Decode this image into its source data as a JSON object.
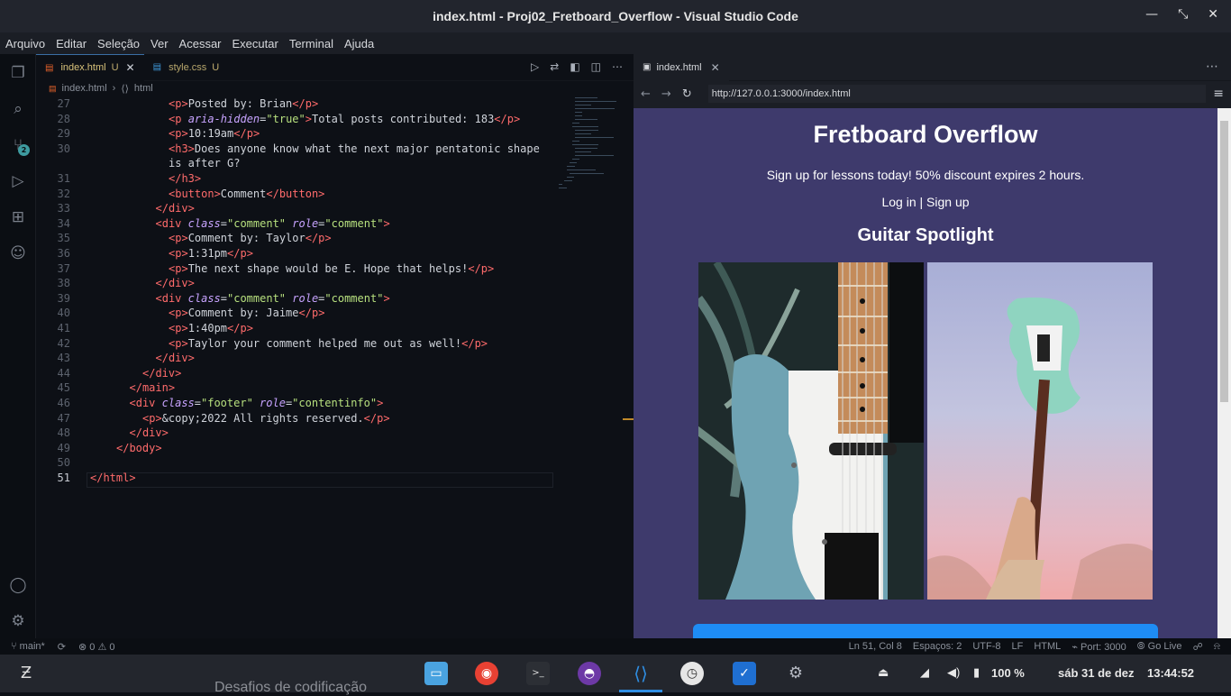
{
  "window": {
    "title": "index.html - Proj02_Fretboard_Overflow - Visual Studio Code"
  },
  "menu": [
    "Arquivo",
    "Editar",
    "Seleção",
    "Ver",
    "Acessar",
    "Executar",
    "Terminal",
    "Ajuda"
  ],
  "tabs": [
    {
      "label": "index.html",
      "status": "U",
      "active": true
    },
    {
      "label": "style.css",
      "status": "U",
      "active": false
    }
  ],
  "breadcrumb": {
    "file": "index.html",
    "node": "html"
  },
  "source_control_badge": "2",
  "code_lines": [
    {
      "n": "27",
      "indent": 6,
      "html": "<span class=\"tg\">&lt;p&gt;</span>Posted by: Brian<span class=\"tg\">&lt;/p&gt;</span>"
    },
    {
      "n": "28",
      "indent": 6,
      "html": "<span class=\"tg\">&lt;p</span> <span class=\"at\">aria-hidden</span>=<span class=\"st\">\"true\"</span><span class=\"tg\">&gt;</span>Total posts contributed: 183<span class=\"tg\">&lt;/p&gt;</span>"
    },
    {
      "n": "29",
      "indent": 6,
      "html": "<span class=\"tg\">&lt;p&gt;</span>10:19am<span class=\"tg\">&lt;/p&gt;</span>"
    },
    {
      "n": "30",
      "indent": 6,
      "html": "<span class=\"tg\">&lt;h3&gt;</span>Does anyone know what the next major pentatonic shape"
    },
    {
      "n": "",
      "indent": 6,
      "html": "is after G?"
    },
    {
      "n": "31",
      "indent": 6,
      "html": "<span class=\"tg\">&lt;/h3&gt;</span>"
    },
    {
      "n": "32",
      "indent": 6,
      "html": "<span class=\"tg\">&lt;button&gt;</span>Comment<span class=\"tg\">&lt;/button&gt;</span>"
    },
    {
      "n": "33",
      "indent": 5,
      "html": "<span class=\"tg\">&lt;/div&gt;</span>"
    },
    {
      "n": "34",
      "indent": 5,
      "html": "<span class=\"tg\">&lt;div</span> <span class=\"at\">class</span>=<span class=\"st\">\"comment\"</span> <span class=\"at\">role</span>=<span class=\"st\">\"comment\"</span><span class=\"tg\">&gt;</span>"
    },
    {
      "n": "35",
      "indent": 6,
      "html": "<span class=\"tg\">&lt;p&gt;</span>Comment by: Taylor<span class=\"tg\">&lt;/p&gt;</span>"
    },
    {
      "n": "36",
      "indent": 6,
      "html": "<span class=\"tg\">&lt;p&gt;</span>1:31pm<span class=\"tg\">&lt;/p&gt;</span>"
    },
    {
      "n": "37",
      "indent": 6,
      "html": "<span class=\"tg\">&lt;p&gt;</span>The next shape would be E. Hope that helps!<span class=\"tg\">&lt;/p&gt;</span>"
    },
    {
      "n": "38",
      "indent": 5,
      "html": "<span class=\"tg\">&lt;/div&gt;</span>"
    },
    {
      "n": "39",
      "indent": 5,
      "html": "<span class=\"tg\">&lt;div</span> <span class=\"at\">class</span>=<span class=\"st\">\"comment\"</span> <span class=\"at\">role</span>=<span class=\"st\">\"comment\"</span><span class=\"tg\">&gt;</span>"
    },
    {
      "n": "40",
      "indent": 6,
      "html": "<span class=\"tg\">&lt;p&gt;</span>Comment by: Jaime<span class=\"tg\">&lt;/p&gt;</span>"
    },
    {
      "n": "41",
      "indent": 6,
      "html": "<span class=\"tg\">&lt;p&gt;</span>1:40pm<span class=\"tg\">&lt;/p&gt;</span>"
    },
    {
      "n": "42",
      "indent": 6,
      "html": "<span class=\"tg\">&lt;p&gt;</span>Taylor your comment helped me out as well!<span class=\"tg\">&lt;/p&gt;</span>"
    },
    {
      "n": "43",
      "indent": 5,
      "html": "<span class=\"tg\">&lt;/div&gt;</span>"
    },
    {
      "n": "44",
      "indent": 4,
      "html": "<span class=\"tg\">&lt;/div&gt;</span>"
    },
    {
      "n": "45",
      "indent": 3,
      "html": "<span class=\"tg\">&lt;/main&gt;</span>"
    },
    {
      "n": "46",
      "indent": 3,
      "html": "<span class=\"tg\">&lt;div</span> <span class=\"at\">class</span>=<span class=\"st\">\"footer\"</span> <span class=\"at\">role</span>=<span class=\"st\">\"contentinfo\"</span><span class=\"tg\">&gt;</span>"
    },
    {
      "n": "47",
      "indent": 4,
      "html": "<span class=\"tg\">&lt;p&gt;</span>&amp;copy;2022 All rights reserved.<span class=\"tg\">&lt;/p&gt;</span>"
    },
    {
      "n": "48",
      "indent": 3,
      "html": "<span class=\"tg\">&lt;/div&gt;</span>"
    },
    {
      "n": "49",
      "indent": 2,
      "html": "<span class=\"tg\">&lt;/body&gt;</span>"
    },
    {
      "n": "50",
      "indent": 0,
      "html": ""
    },
    {
      "n": "51",
      "indent": 0,
      "html": "<span class=\"tg\">&lt;/html&gt;</span>"
    }
  ],
  "preview": {
    "tab_label": "index.html",
    "url": "http://127.0.0.1:3000/index.html",
    "site_title": "Fretboard Overflow",
    "site_subtitle": "Sign up for lessons today! 50% discount expires 2 hours.",
    "auth_text": "Log in | Sign up",
    "section_heading": "Guitar Spotlight"
  },
  "status": {
    "branch": "main*",
    "problems": "⊗ 0 ⚠ 0",
    "position": "Ln 51, Col 8",
    "spaces": "Espaços: 2",
    "encoding": "UTF-8",
    "eol": "LF",
    "language": "HTML",
    "port": "Port: 3000",
    "golive": "Go Live"
  },
  "taskbar": {
    "battery": "100 %",
    "date": "sáb 31 de dez",
    "time": "13:44:52",
    "background_text": "Desafios de codificação"
  },
  "colors": {
    "accent": "#3e9ba0",
    "webview_bg": "#3e3a6c",
    "cta_blue": "#1e8cf5"
  }
}
